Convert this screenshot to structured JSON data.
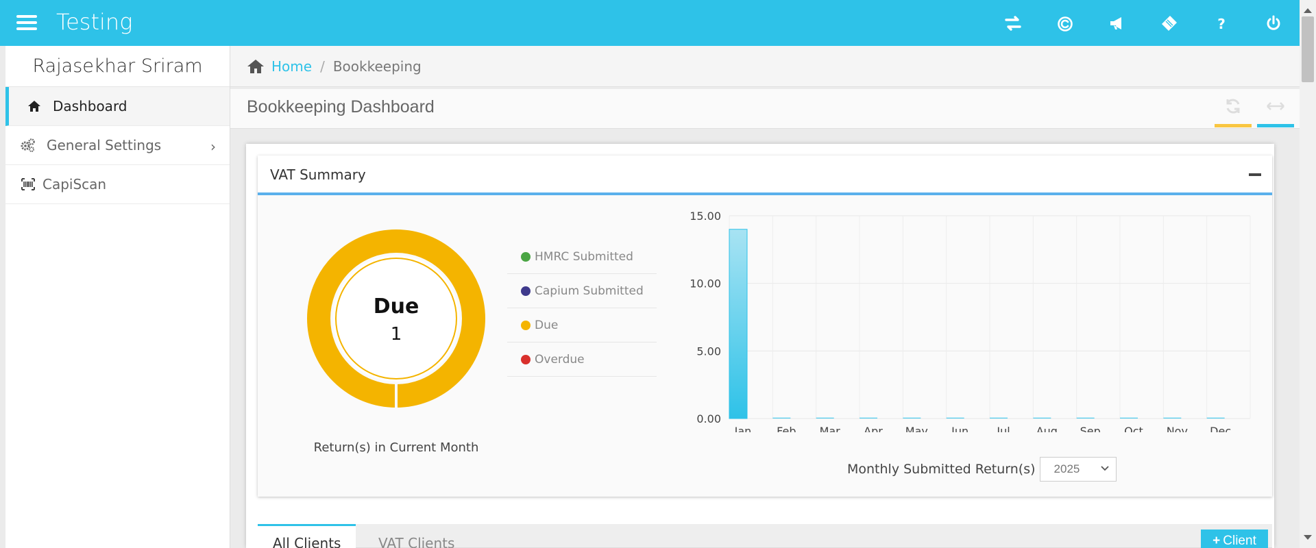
{
  "header": {
    "app_title": "Testing",
    "icons": [
      "transfer-icon",
      "capium-icon",
      "megaphone-icon",
      "ticket-icon",
      "help-icon",
      "power-icon"
    ],
    "background_color": "#2ec2e8"
  },
  "sidebar": {
    "user_name": "Rajasekhar Sriram",
    "items": [
      {
        "label": "Dashboard",
        "icon": "home-icon",
        "active": true
      },
      {
        "label": "General Settings",
        "icon": "gears-icon",
        "has_submenu": true
      },
      {
        "label": "CapiScan",
        "icon": "barcode-icon"
      }
    ]
  },
  "breadcrumb": {
    "home": "Home",
    "separator": "/",
    "current": "Bookkeeping"
  },
  "page": {
    "title": "Bookkeeping Dashboard",
    "refresh_bar_color": "#f9c642",
    "expand_bar_color": "#2ec2e8"
  },
  "vat_summary": {
    "title": "VAT Summary",
    "donut": {
      "label": "Due",
      "count": "1",
      "color": "#f4b400",
      "caption": "Return(s) in Current Month"
    },
    "legend": [
      {
        "label": "HMRC Submitted",
        "color": "#4aa544"
      },
      {
        "label": "Capium Submitted",
        "color": "#3f3a8c"
      },
      {
        "label": "Due",
        "color": "#f4b400"
      },
      {
        "label": "Overdue",
        "color": "#d9302c"
      }
    ],
    "chart_footer": {
      "label": "Monthly Submitted Return(s)",
      "year": "2025"
    }
  },
  "chart_data": {
    "type": "bar",
    "categories": [
      "Jan",
      "Feb",
      "Mar",
      "Apr",
      "May",
      "Jun",
      "Jul",
      "Aug",
      "Sep",
      "Oct",
      "Nov",
      "Dec"
    ],
    "values": [
      14,
      0,
      0,
      0,
      0,
      0,
      0,
      0,
      0,
      0,
      0,
      0
    ],
    "y_ticks": [
      "15.00",
      "10.00",
      "5.00",
      "0.00"
    ],
    "ylim": [
      0,
      15
    ],
    "color": "#2ec2e8",
    "grid": true
  },
  "tabs": {
    "all_clients": "All Clients",
    "vat_clients": "VAT Clients",
    "add_client": "Client"
  }
}
